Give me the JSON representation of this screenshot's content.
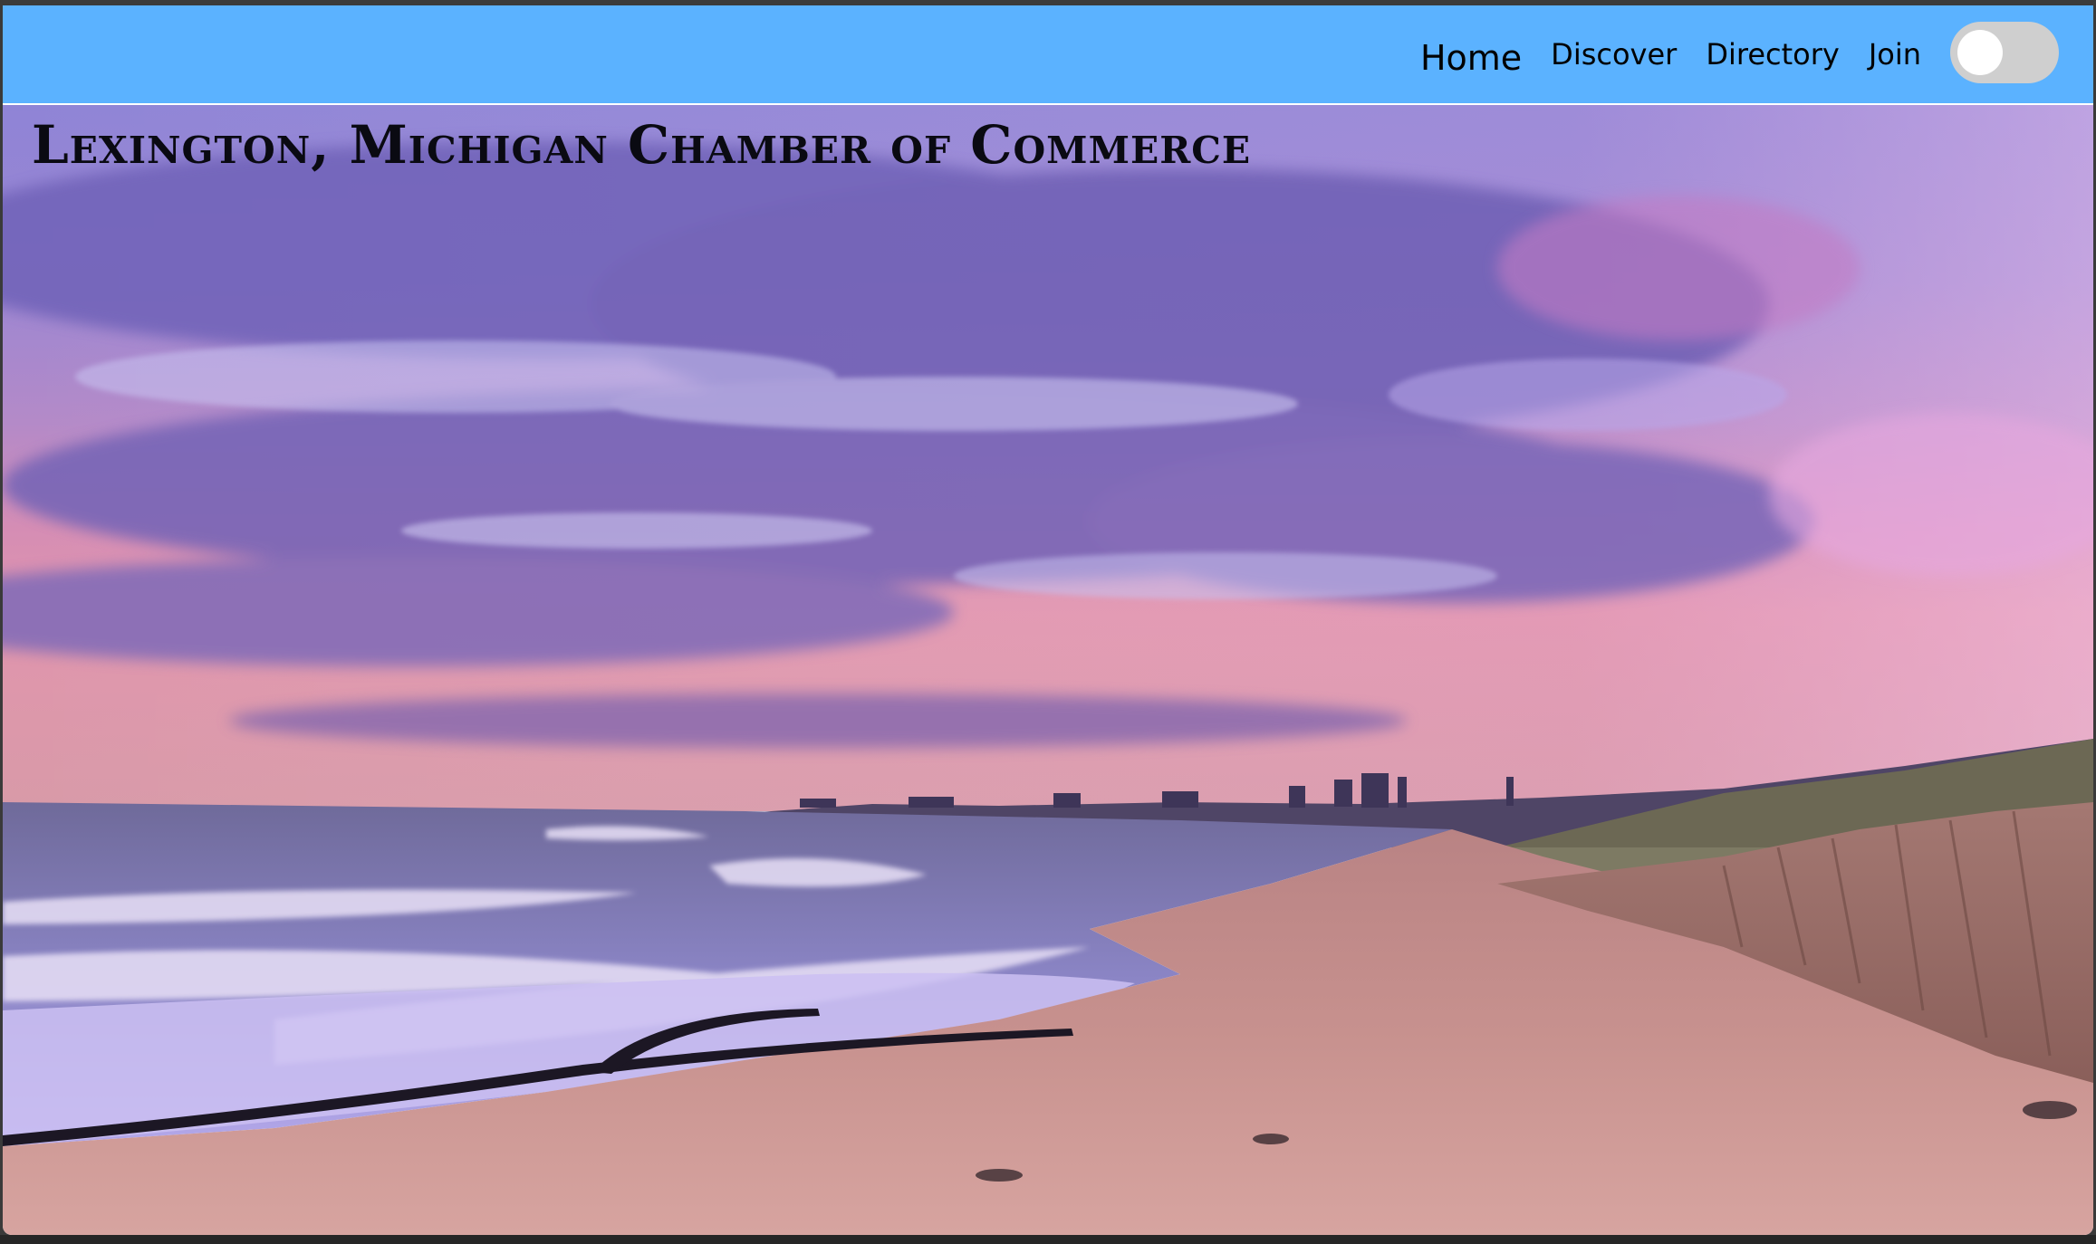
{
  "nav": {
    "items": [
      {
        "label": "Home"
      },
      {
        "label": "Discover"
      },
      {
        "label": "Directory"
      },
      {
        "label": "Join"
      }
    ],
    "dark_mode_toggle": {
      "checked": false
    }
  },
  "hero": {
    "title": "Lexington, Michigan Chamber of Commerce",
    "image": "beach-sunset-photo"
  },
  "colors": {
    "navbar": "#5bb2ff",
    "toggle_track": "#cfcfcf",
    "title_text": "#0a0a12"
  }
}
